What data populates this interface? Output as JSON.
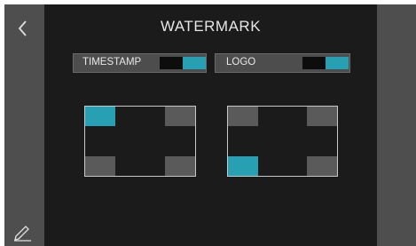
{
  "header": {
    "title": "WATERMARK"
  },
  "toggles": [
    {
      "label": "TIMESTAMP",
      "enabled": true
    },
    {
      "label": "LOGO",
      "enabled": true
    }
  ],
  "positions": {
    "timestamp": "top-left",
    "logo": "bottom-left"
  },
  "colors": {
    "accent": "#28a0b4",
    "corner_inactive": "#5a5a5a",
    "background": "#1b1b1b",
    "rail": "#4e4e4e"
  },
  "icons": {
    "back": "back-chevron-icon",
    "edit": "pencil-icon"
  }
}
